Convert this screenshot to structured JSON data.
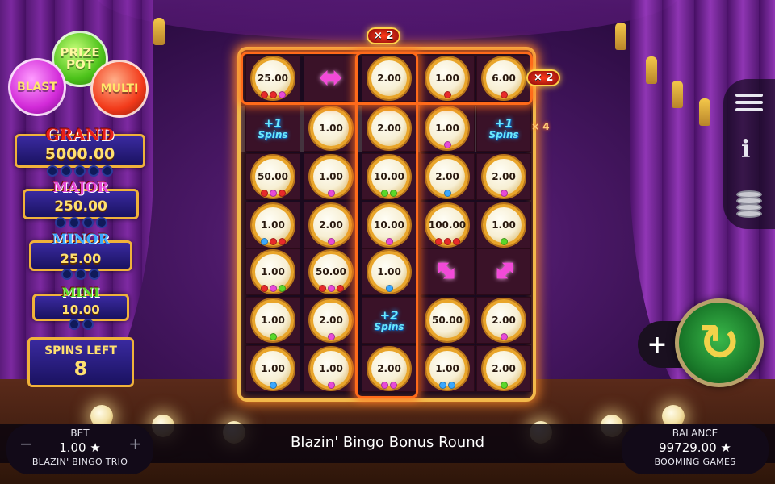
{
  "bubbles": {
    "prize_pot": "PRIZE POT",
    "blast": "BLAST",
    "multi": "MULTI"
  },
  "jackpots": [
    {
      "name": "GRAND",
      "value": "5000.00",
      "dots": 5,
      "color": "#e8201a"
    },
    {
      "name": "MAJOR",
      "value": "250.00",
      "dots": 4,
      "color": "#e84ad8"
    },
    {
      "name": "MINOR",
      "value": "25.00",
      "dots": 3,
      "color": "#3aa8ff"
    },
    {
      "name": "MINI",
      "value": "10.00",
      "dots": 2,
      "color": "#5ad82a"
    }
  ],
  "spins_left": {
    "label": "SPINS LEFT",
    "value": "8"
  },
  "multipliers": {
    "column": "× 2",
    "row": "× 2",
    "row2": "× 4"
  },
  "grid": [
    [
      {
        "t": "coin",
        "v": "25.00",
        "d": [
          "#e82a2a",
          "#e82a2a",
          "#e84ad8"
        ]
      },
      {
        "t": "arrow-h"
      },
      {
        "t": "coin",
        "v": "2.00",
        "d": []
      },
      {
        "t": "coin",
        "v": "1.00",
        "d": [
          "#e82a2a"
        ]
      },
      {
        "t": "coin",
        "v": "6.00",
        "d": [
          "#e82a2a"
        ]
      }
    ],
    [
      {
        "t": "spins",
        "v": "+1",
        "s": "Spins"
      },
      {
        "t": "coin",
        "v": "1.00",
        "d": []
      },
      {
        "t": "coin",
        "v": "2.00",
        "d": []
      },
      {
        "t": "coin",
        "v": "1.00",
        "d": [
          "#e84ad8"
        ]
      },
      {
        "t": "spins",
        "v": "+1",
        "s": "Spins"
      }
    ],
    [
      {
        "t": "coin",
        "v": "50.00",
        "d": [
          "#e82a2a",
          "#e84ad8",
          "#e82a2a"
        ]
      },
      {
        "t": "coin",
        "v": "1.00",
        "d": [
          "#e84ad8"
        ]
      },
      {
        "t": "coin",
        "v": "10.00",
        "d": [
          "#5ad82a",
          "#5ad82a"
        ]
      },
      {
        "t": "coin",
        "v": "2.00",
        "d": [
          "#3aa8ff"
        ]
      },
      {
        "t": "coin",
        "v": "2.00",
        "d": [
          "#e84ad8"
        ]
      }
    ],
    [
      {
        "t": "coin",
        "v": "1.00",
        "d": [
          "#3aa8ff",
          "#e82a2a",
          "#e82a2a"
        ]
      },
      {
        "t": "coin",
        "v": "2.00",
        "d": [
          "#e84ad8"
        ]
      },
      {
        "t": "coin",
        "v": "10.00",
        "d": [
          "#e84ad8"
        ]
      },
      {
        "t": "coin",
        "v": "100.00",
        "d": [
          "#e82a2a",
          "#e82a2a",
          "#e82a2a"
        ]
      },
      {
        "t": "coin",
        "v": "1.00",
        "d": [
          "#5ad82a"
        ]
      }
    ],
    [
      {
        "t": "coin",
        "v": "1.00",
        "d": [
          "#e82a2a",
          "#e84ad8",
          "#5ad82a"
        ]
      },
      {
        "t": "coin",
        "v": "50.00",
        "d": [
          "#e82a2a",
          "#e84ad8",
          "#e82a2a"
        ]
      },
      {
        "t": "coin",
        "v": "1.00",
        "d": [
          "#3aa8ff"
        ]
      },
      {
        "t": "arrow-d"
      },
      {
        "t": "arrow-d2"
      }
    ],
    [
      {
        "t": "coin",
        "v": "1.00",
        "d": [
          "#5ad82a"
        ]
      },
      {
        "t": "coin",
        "v": "2.00",
        "d": [
          "#e84ad8"
        ]
      },
      {
        "t": "spins",
        "v": "+2",
        "s": "Spins"
      },
      {
        "t": "coin",
        "v": "50.00",
        "d": []
      },
      {
        "t": "coin",
        "v": "2.00",
        "d": [
          "#e84ad8"
        ]
      }
    ],
    [
      {
        "t": "coin",
        "v": "1.00",
        "d": [
          "#3aa8ff"
        ]
      },
      {
        "t": "coin",
        "v": "1.00",
        "d": [
          "#e84ad8"
        ]
      },
      {
        "t": "coin",
        "v": "2.00",
        "d": [
          "#e84ad8",
          "#e84ad8"
        ]
      },
      {
        "t": "coin",
        "v": "1.00",
        "d": [
          "#3aa8ff",
          "#3aa8ff"
        ]
      },
      {
        "t": "coin",
        "v": "2.00",
        "d": [
          "#5ad82a"
        ]
      }
    ]
  ],
  "bet": {
    "label": "BET",
    "value": "1.00 ★",
    "game": "BLAZIN' BINGO TRIO",
    "minus": "−",
    "plus": "+"
  },
  "balance": {
    "label": "BALANCE",
    "value": "99729.00 ★",
    "brand": "BOOMING GAMES"
  },
  "round_title": "Blazin' Bingo Bonus Round",
  "icons": [
    "menu-icon",
    "info-icon",
    "coins-icon",
    "plus-icon",
    "spin-icon"
  ]
}
